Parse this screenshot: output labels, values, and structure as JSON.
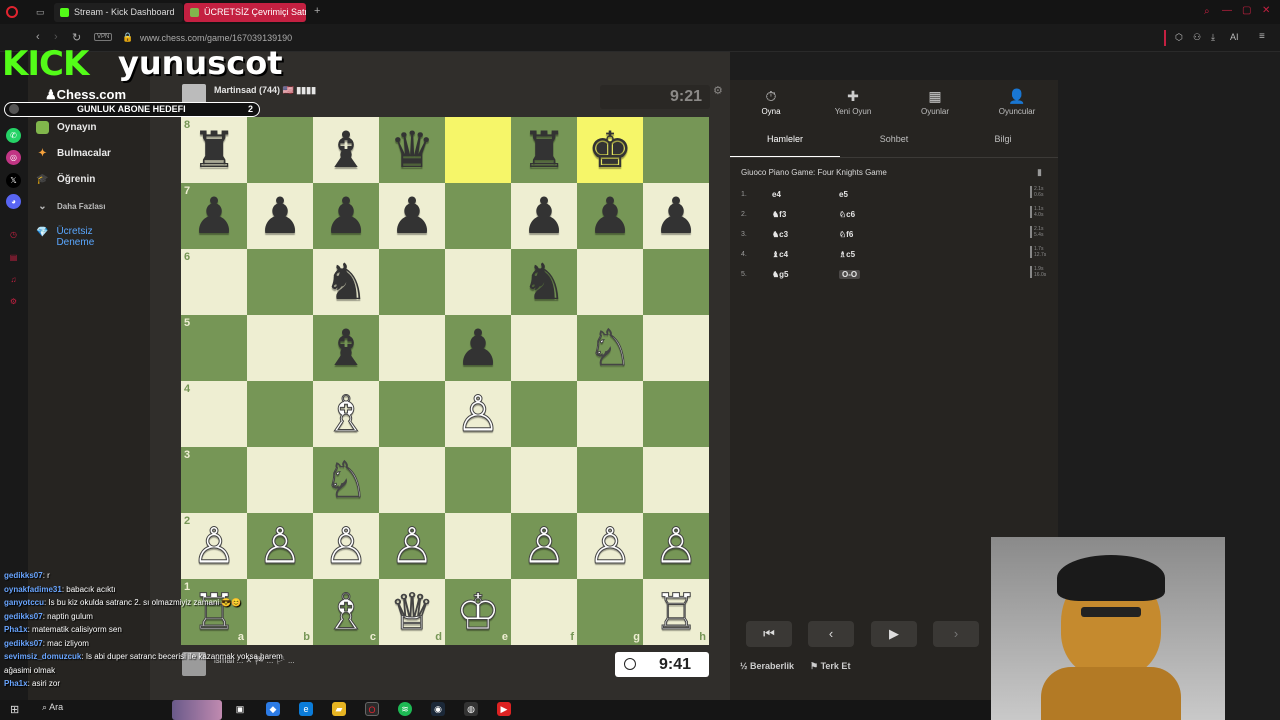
{
  "browser": {
    "tabs": [
      {
        "label": "Stream - Kick Dashboard"
      },
      {
        "label": "ÜCRETSİZ Çevrimiçi Satra"
      }
    ],
    "url": "www.chess.com/game/167039139190",
    "vpn_label": "VPN",
    "ai_label": "AI"
  },
  "overlay": {
    "kick_label": "KICK",
    "channel_name": "yunuscot",
    "goal_label": "GUNLUK ABONE HEDEFI",
    "goal_count": "2"
  },
  "chess_sidebar": {
    "logo": "Chess.com",
    "items": [
      {
        "label": "Oynayın"
      },
      {
        "label": "Bulmacalar"
      },
      {
        "label": "Öğrenin"
      },
      {
        "label": "Daha Fazlası"
      },
      {
        "label": "Ücretsiz Deneme"
      }
    ]
  },
  "game": {
    "top_player": "Martinsad (744) 🇺🇸 ▮▮▮▮",
    "top_clock": "9:21",
    "bottom_clock": "9:41",
    "bottom_player_overlay": "ismail ... ✕ 🏁 ... 🏳 ...",
    "board": {
      "ranks": [
        "8",
        "7",
        "6",
        "5",
        "4",
        "3",
        "2",
        "1"
      ],
      "files": [
        "a",
        "b",
        "c",
        "d",
        "e",
        "f",
        "g",
        "h"
      ],
      "position": [
        [
          "♜",
          "",
          "♝",
          "♛",
          "",
          "♜",
          "♚",
          ""
        ],
        [
          "♟",
          "♟",
          "♟",
          "♟",
          "",
          "♟",
          "♟",
          "♟"
        ],
        [
          "",
          "",
          "♞",
          "",
          "",
          "♞",
          "",
          ""
        ],
        [
          "",
          "",
          "♝",
          "",
          "♟",
          "",
          "♘",
          ""
        ],
        [
          "",
          "",
          "♗",
          "",
          "♙",
          "",
          "",
          ""
        ],
        [
          "",
          "",
          "♘",
          "",
          "",
          "",
          "",
          ""
        ],
        [
          "♙",
          "♙",
          "♙",
          "♙",
          "",
          "♙",
          "♙",
          "♙"
        ],
        [
          "♖",
          "",
          "♗",
          "♕",
          "♔",
          "",
          "",
          "♖"
        ]
      ],
      "highlight": [
        "e8",
        "g8"
      ]
    }
  },
  "right_panel": {
    "top_tabs": [
      {
        "label": "Oyna",
        "glyph": "⏱"
      },
      {
        "label": "Yeni Oyun",
        "glyph": "✚"
      },
      {
        "label": "Oyunlar",
        "glyph": "▦"
      },
      {
        "label": "Oyuncular",
        "glyph": "👤"
      }
    ],
    "sub_tabs": [
      "Hamleler",
      "Sohbet",
      "Bilgi"
    ],
    "opening": "Giuoco Piano Game: Four Knights Game",
    "moves": [
      {
        "num": "1.",
        "white": "e4",
        "black": "e5",
        "t1": "2.1s",
        "t2": "0.6s"
      },
      {
        "num": "2.",
        "white": "♞f3",
        "black": "♘c6",
        "t1": "1.1s",
        "t2": "4.0s"
      },
      {
        "num": "3.",
        "white": "♞c3",
        "black": "♘f6",
        "t1": "2.1s",
        "t2": "5.4s"
      },
      {
        "num": "4.",
        "white": "♝c4",
        "black": "♗c5",
        "t1": "1.7s",
        "t2": "12.7s"
      },
      {
        "num": "5.",
        "white": "♞g5",
        "black": "O-O",
        "t1": "1.9s",
        "t2": "16.0s"
      }
    ],
    "draw_label": "Beraberlik",
    "resign_label": "Terk Et",
    "half": "½"
  },
  "chat": [
    {
      "user": "gedikks07",
      "msg": ": r"
    },
    {
      "user": "oynakfadime31",
      "msg": ": babacık acıktı"
    },
    {
      "user": "ganyotccu",
      "msg": ": Is bu kiz okulda satranc 2. sı olmazmiyiz zamani 😎😊"
    },
    {
      "user": "gedikks07",
      "msg": ": naptin gulum"
    },
    {
      "user": "Pha1x",
      "msg": ": matematik calisiyorm sen"
    },
    {
      "user": "gedikks07",
      "msg": ": mac izliyom"
    },
    {
      "user": "sevimsiz_domuzcuk",
      "msg": ": Is abi duper satranc becerisi ile kazanmak yoksa harem"
    },
    {
      "user": "",
      "msg": "ağasimi olmak"
    },
    {
      "user": "Pha1x",
      "msg": ": asiri zor"
    }
  ],
  "taskbar": {
    "search_label": "Ara"
  },
  "colors": {
    "board_light": "#eeeed2",
    "board_dark": "#769656",
    "highlight": "#f6f669",
    "kick_green": "#53fc18",
    "tab_active": "#c42041"
  }
}
